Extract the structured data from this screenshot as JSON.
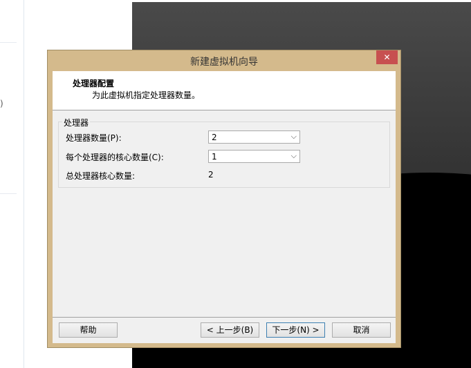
{
  "background": {
    "left_fragment_char": ")"
  },
  "dialog": {
    "title": "新建虚拟机向导",
    "close_glyph": "✕",
    "header": {
      "title": "处理器配置",
      "subtitle": "为此虚拟机指定处理器数量。"
    },
    "group": {
      "label": "处理器",
      "processor_count": {
        "label": "处理器数量(P):",
        "value": "2"
      },
      "cores_per_processor": {
        "label": "每个处理器的核心数量(C):",
        "value": "1"
      },
      "total_cores": {
        "label": "总处理器核心数量:",
        "value": "2"
      }
    },
    "buttons": {
      "help": "帮助",
      "back": "< 上一步(B)",
      "next": "下一步(N) >",
      "cancel": "取消"
    }
  },
  "colors": {
    "title_bar": "#d4ba8c",
    "close_button": "#c75050",
    "client_background": "#f0f0f0"
  }
}
